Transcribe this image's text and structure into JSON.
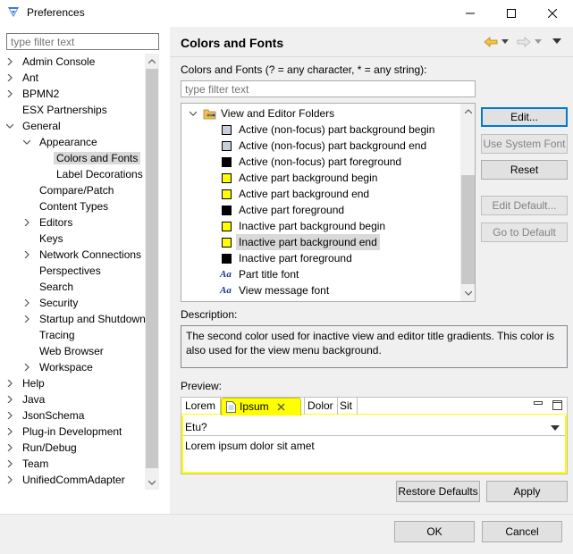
{
  "window": {
    "title": "Preferences"
  },
  "sidebar": {
    "filter_placeholder": "type filter text",
    "items": [
      {
        "label": "Admin Console",
        "twisty": "closed"
      },
      {
        "label": "Ant",
        "twisty": "closed"
      },
      {
        "label": "BPMN2",
        "twisty": "closed"
      },
      {
        "label": "ESX Partnerships",
        "twisty": "none"
      },
      {
        "label": "General",
        "twisty": "open"
      },
      {
        "label": "Appearance",
        "twisty": "open"
      },
      {
        "label": "Colors and Fonts",
        "twisty": "none"
      },
      {
        "label": "Label Decorations",
        "twisty": "none"
      },
      {
        "label": "Compare/Patch",
        "twisty": "none"
      },
      {
        "label": "Content Types",
        "twisty": "none"
      },
      {
        "label": "Editors",
        "twisty": "closed"
      },
      {
        "label": "Keys",
        "twisty": "none"
      },
      {
        "label": "Network Connections",
        "twisty": "closed"
      },
      {
        "label": "Perspectives",
        "twisty": "none"
      },
      {
        "label": "Search",
        "twisty": "none"
      },
      {
        "label": "Security",
        "twisty": "closed"
      },
      {
        "label": "Startup and Shutdown",
        "twisty": "closed"
      },
      {
        "label": "Tracing",
        "twisty": "none"
      },
      {
        "label": "Web Browser",
        "twisty": "none"
      },
      {
        "label": "Workspace",
        "twisty": "closed"
      },
      {
        "label": "Help",
        "twisty": "closed"
      },
      {
        "label": "Java",
        "twisty": "closed"
      },
      {
        "label": "JsonSchema",
        "twisty": "closed"
      },
      {
        "label": "Plug-in Development",
        "twisty": "closed"
      },
      {
        "label": "Run/Debug",
        "twisty": "closed"
      },
      {
        "label": "Team",
        "twisty": "closed"
      },
      {
        "label": "UnifiedCommAdapter",
        "twisty": "closed"
      }
    ]
  },
  "page": {
    "title": "Colors and Fonts",
    "tree_label": "Colors and Fonts (? = any character, * = any string):",
    "filter_placeholder": "type filter text",
    "tree": {
      "folder": "View and Editor Folders",
      "items": [
        {
          "label": "Active (non-focus) part background begin",
          "kind": "color",
          "color": "#c8d0dc"
        },
        {
          "label": "Active (non-focus) part background end",
          "kind": "color",
          "color": "#c8d0dc"
        },
        {
          "label": "Active (non-focus) part foreground",
          "kind": "color",
          "color": "#000000"
        },
        {
          "label": "Active part background begin",
          "kind": "color",
          "color": "#ffff00"
        },
        {
          "label": "Active part background end",
          "kind": "color",
          "color": "#ffff00"
        },
        {
          "label": "Active part foreground",
          "kind": "color",
          "color": "#000000"
        },
        {
          "label": "Inactive part background begin",
          "kind": "color",
          "color": "#ffff00"
        },
        {
          "label": "Inactive part background end",
          "kind": "color",
          "color": "#ffff00"
        },
        {
          "label": "Inactive part foreground",
          "kind": "color",
          "color": "#000000"
        },
        {
          "label": "Part title font",
          "kind": "font"
        },
        {
          "label": "View message font",
          "kind": "font"
        }
      ]
    },
    "buttons": {
      "edit": "Edit...",
      "use_system_font": "Use System Font",
      "reset": "Reset",
      "edit_default": "Edit Default...",
      "go_to_default": "Go to Default"
    },
    "description_label": "Description:",
    "description": "The second color used for inactive view and editor title gradients.  This color is also used for the view menu background.",
    "preview_label": "Preview:",
    "preview": {
      "tabs": [
        "Lorem",
        "Ipsum",
        "Dolor",
        "Sit"
      ],
      "combo_value": "Etu?",
      "text": "Lorem ipsum dolor sit amet",
      "highlight_color": "#ffff00"
    },
    "restore_defaults": "Restore Defaults",
    "apply": "Apply"
  },
  "footer": {
    "ok": "OK",
    "cancel": "Cancel"
  },
  "icons": {
    "back": "back-arrow-icon",
    "forward": "forward-arrow-icon",
    "menu": "view-menu-icon"
  },
  "colors": {
    "accent": "#0078d7",
    "selection": "#d9d9d9",
    "preview_highlight": "#ffff00"
  }
}
